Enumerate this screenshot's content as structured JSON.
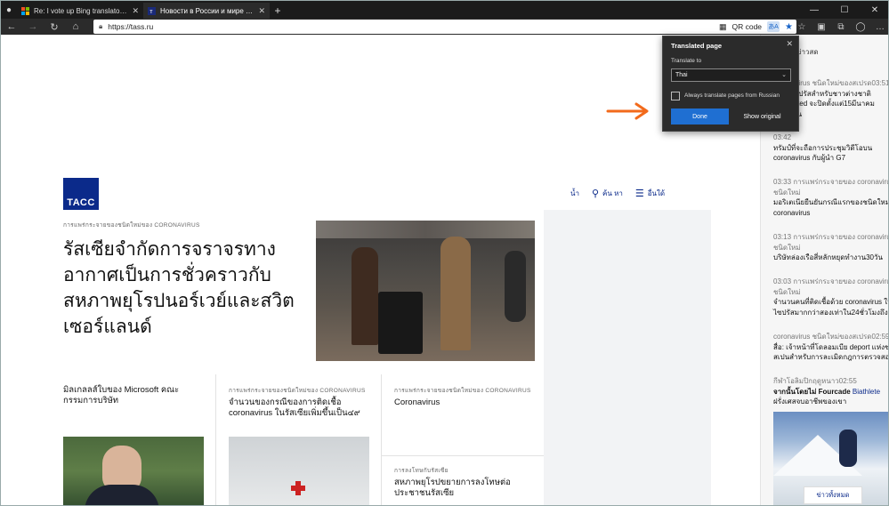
{
  "tabs": [
    {
      "title": "Re: I vote up Bing translator exte",
      "active": false
    },
    {
      "title": "Новости в России и мире - ТАСС",
      "active": true
    }
  ],
  "address": {
    "url": "https://tass.ru",
    "qr_label": "QR code"
  },
  "site": {
    "logo_text": "ТАСС",
    "nav_news": "น้ำ",
    "nav_search": "ค้น หา",
    "nav_more": "อื่นใด้"
  },
  "hero": {
    "kicker": "การแพร่กระจายของชนิดใหม่ของ CORONAVIRUS",
    "headline": "รัสเซียจำกัดการจราจรทางอากาศเป็นการชั่วคราวกับสหภาพยุโรปนอร์เวย์และสวิตเซอร์แลนด์"
  },
  "cards": {
    "card1_title": "มิลเกลลส์ใบของ Microsoft คณะกรรมการบริษัท",
    "card2_kicker": "การแพร่กระจายของชนิดใหม่ของ CORONAVIRUS",
    "card2_title": "จำนวนของกรณีของการติดเชื้อ coronavirus ในรัสเซียเพิ่มขึ้นเป็น๔๙",
    "card3_kicker": "การแพร่กระจายของชนิดใหม่ของ CORONAVIRUS",
    "card3_title": "Coronavirus",
    "card4_kicker": "การลงโทษกับรัสเซีย",
    "card4_title": "สหภาพยุโรปขยายการลงโทษต่อประชาชนรัสเซีย"
  },
  "sidebar": {
    "header": "ข่าวสด",
    "items": [
      {
        "meta": "coronavirus ชนิดใหม่ของสเปรด03:51",
        "lines": [
          "นำไปใช้ปรัสสำหรับชาวต่างชาติ",
          "ของ edited จะปิดตั้งแต่15มีนาคม",
          "เป็น25วัน"
        ]
      },
      {
        "meta": "03:42",
        "lines": [
          "ทรัมป์ที่จะถือการประชุมวิดีโอบน",
          "coronavirus กับผู้นำ G7"
        ]
      },
      {
        "meta": "03:33 การแพร่กระจายของ coronavirus",
        "meta2": "ชนิดใหม่",
        "lines": [
          "มอริเตเนียยืนยันกรณีแรกของชนิดใหม่",
          "coronavirus"
        ]
      },
      {
        "meta": "03:13 การแพร่กระจายของ coronavirus",
        "meta2": "ชนิดใหม่",
        "lines": [
          "บริษัทล่องเรือสี่หลักหยุดทำงาน30วัน"
        ]
      },
      {
        "meta": "03:03 การแพร่กระจายของ coronavirus",
        "meta2": "ชนิดใหม่",
        "lines": [
          "จำนวนคนที่ติดเชื้อด้วย coronavirus ใน",
          "ไซปรัสมากกว่าสองเท่าใน24ชั่วโมงถึง26"
        ]
      },
      {
        "meta": "coronavirus ชนิดใหม่ของสเปรด02:59",
        "lines": [
          "สื่อ: เจ้าหน้าที่โดลอมเบีย deport แห่งชา",
          "สเปนสำหรับการละเมิดกฎการตรวจสอบ"
        ]
      },
      {
        "meta": "กีฬาโอลิมปิกฤดูหนาว02:55",
        "lines_mixed": {
          "prefix": "จากนั้นโดยไม่ Fourcade",
          "suffix": " Biathlete"
        },
        "lines": [
          "ฝรั่งเศสจบอาชีพของเขา"
        ]
      }
    ],
    "more": "ข่าวทั้งหมด"
  },
  "translate_popup": {
    "title": "Translated page",
    "translate_to_label": "Translate to",
    "language": "Thai",
    "checkbox_label": "Always translate pages from Russian",
    "done": "Done",
    "show_original": "Show original"
  },
  "colors": {
    "accent": "#0b2a8a",
    "arrow": "#f26a1b",
    "done_button": "#1f6fd2"
  }
}
